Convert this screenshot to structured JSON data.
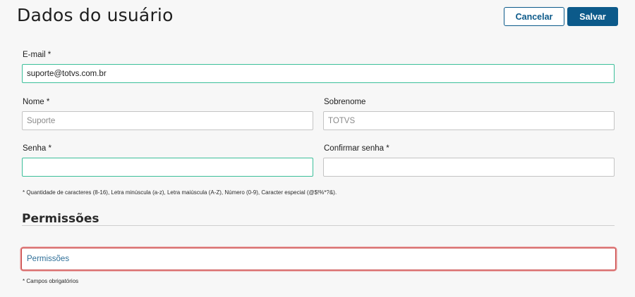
{
  "header": {
    "title": "Dados do usuário",
    "cancel_label": "Cancelar",
    "save_label": "Salvar"
  },
  "form": {
    "email": {
      "label": "E-mail *",
      "value": "suporte@totvs.com.br"
    },
    "first_name": {
      "label": "Nome *",
      "placeholder": "Suporte"
    },
    "last_name": {
      "label": "Sobrenome",
      "placeholder": "TOTVS"
    },
    "password": {
      "label": "Senha *",
      "value": ""
    },
    "confirm_password": {
      "label": "Confirmar senha *",
      "value": ""
    },
    "password_hint": "* Quantidade de caracteres (8-16), Letra minúscula (a-z), Letra maiúscula (A-Z), Número (0-9), Caracter especial (@$!%*?&)."
  },
  "permissions": {
    "section_title": "Permissões",
    "field_label": "Permissões"
  },
  "footer": {
    "required_note": "* Campos obrigatórios"
  },
  "colors": {
    "primary": "#0c5a8a",
    "focus_border": "#3cbf9a",
    "highlight_border": "#c84646",
    "link_text": "#2f6f98"
  }
}
